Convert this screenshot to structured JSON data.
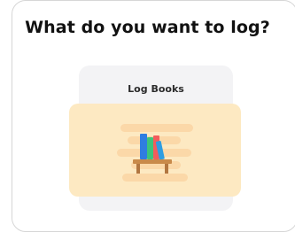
{
  "header": {
    "title": "What do you want to log?"
  },
  "options": [
    {
      "label": "Log Books",
      "icon": "bookshelf-icon",
      "accent_color": "#fde9c2"
    }
  ],
  "colors": {
    "card_background": "#f3f3f5",
    "title_text": "#111111"
  }
}
